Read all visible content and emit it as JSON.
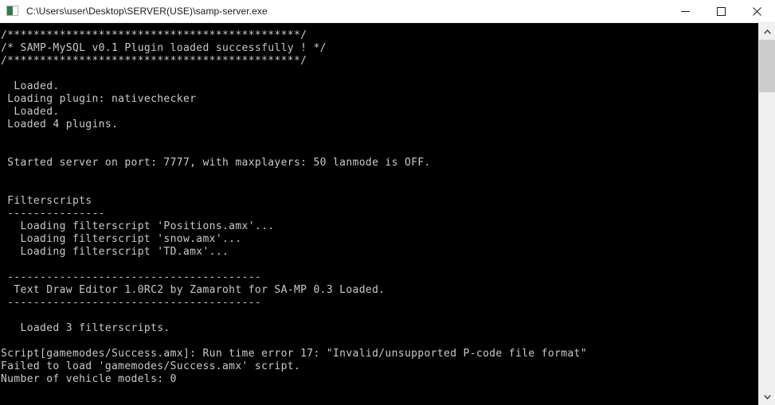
{
  "window": {
    "title": "C:\\Users\\user\\Desktop\\SERVER(USE)\\samp-server.exe",
    "icon": "console-app-icon",
    "controls": {
      "minimize_label": "Minimize",
      "maximize_label": "Maximize",
      "close_label": "Close"
    },
    "colors": {
      "titlebar_background": "#ffffff",
      "titlebar_text": "#1b1b1b",
      "console_background": "#000000",
      "console_text": "#c9c9c9",
      "scrollbar_track": "#f0f0f0",
      "scrollbar_thumb": "#cdcdcd",
      "close_hover": "#e81123"
    }
  },
  "console": {
    "lines": [
      "/*********************************************/",
      "/* SAMP-MySQL v0.1 Plugin loaded successfully ! */",
      "/*********************************************/",
      "",
      "  Loaded.",
      " Loading plugin: nativechecker",
      "  Loaded.",
      " Loaded 4 plugins.",
      "",
      "",
      " Started server on port: 7777, with maxplayers: 50 lanmode is OFF.",
      "",
      "",
      " Filterscripts",
      " ---------------",
      "   Loading filterscript 'Positions.amx'...",
      "   Loading filterscript 'snow.amx'...",
      "   Loading filterscript 'TD.amx'...",
      "",
      " ---------------------------------------",
      "  Text Draw Editor 1.0RC2 by Zamaroht for SA-MP 0.3 Loaded.",
      " ---------------------------------------",
      "",
      "   Loaded 3 filterscripts.",
      "",
      "Script[gamemodes/Success.amx]: Run time error 17: \"Invalid/unsupported P-code file format\"",
      "Failed to load 'gamemodes/Success.amx' script.",
      "Number of vehicle models: 0"
    ]
  },
  "scrollbar": {
    "up_arrow": "chevron-up-icon",
    "down_arrow": "chevron-down-icon",
    "thumb_top_percent": 0,
    "thumb_height_percent": 15
  }
}
